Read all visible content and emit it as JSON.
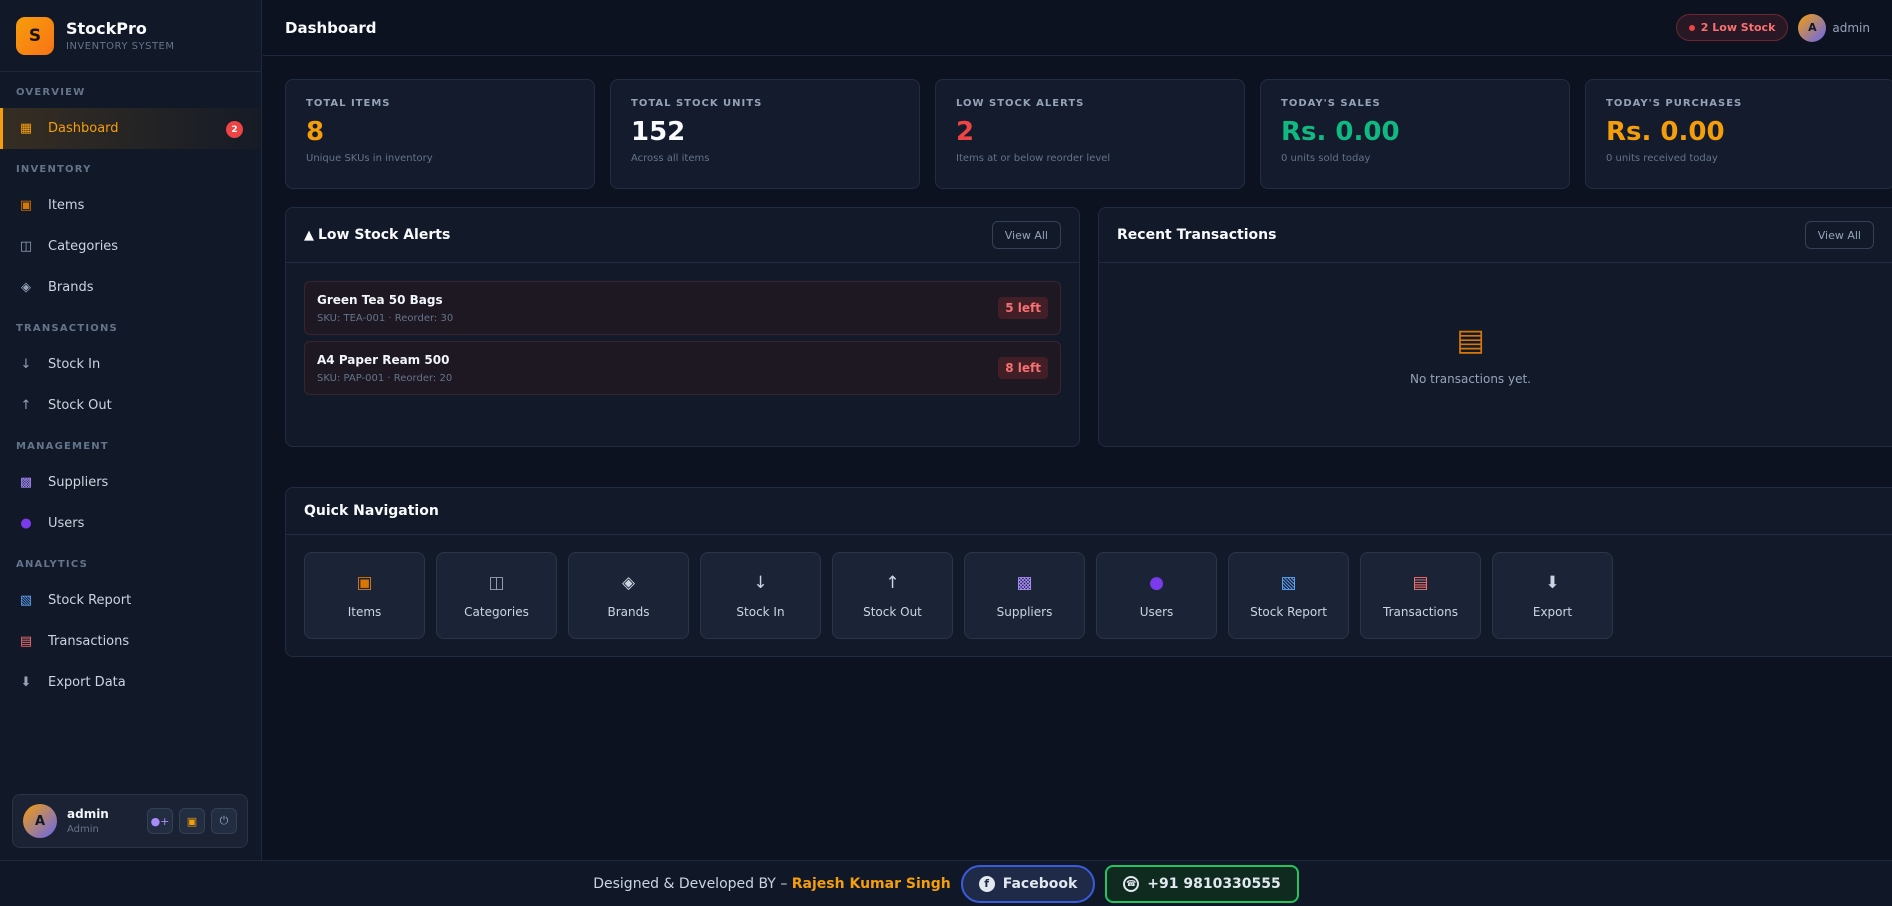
{
  "brand": {
    "logo_letter": "S",
    "name": "StockPro",
    "subtitle": "INVENTORY SYSTEM"
  },
  "sidebar": {
    "sections": {
      "overview": "OVERVIEW",
      "inventory": "INVENTORY",
      "transactions": "TRANSACTIONS",
      "management": "MANAGEMENT",
      "analytics": "ANALYTICS"
    },
    "items": {
      "dashboard": {
        "label": "Dashboard",
        "icon": "grid-icon",
        "badge": "2"
      },
      "items": {
        "label": "Items",
        "icon": "box-icon"
      },
      "categories": {
        "label": "Categories",
        "icon": "tag-icon"
      },
      "brands": {
        "label": "Brands",
        "icon": "diamond-icon"
      },
      "stock_in": {
        "label": "Stock In",
        "icon": "arrow-down-icon"
      },
      "stock_out": {
        "label": "Stock Out",
        "icon": "arrow-up-icon"
      },
      "suppliers": {
        "label": "Suppliers",
        "icon": "factory-icon"
      },
      "users": {
        "label": "Users",
        "icon": "user-icon"
      },
      "stock_report": {
        "label": "Stock Report",
        "icon": "chart-icon"
      },
      "transactions": {
        "label": "Transactions",
        "icon": "clipboard-icon"
      },
      "export": {
        "label": "Export Data",
        "icon": "download-icon"
      }
    }
  },
  "user": {
    "initial": "A",
    "name": "admin",
    "role": "Admin"
  },
  "topbar": {
    "title": "Dashboard",
    "low_stock_label": "2 Low Stock",
    "avatar_initial": "A",
    "username": "admin"
  },
  "stats": [
    {
      "label": "TOTAL ITEMS",
      "value": "8",
      "sub": "Unique SKUs in inventory",
      "color": "#f59e0b"
    },
    {
      "label": "TOTAL STOCK UNITS",
      "value": "152",
      "sub": "Across all items",
      "color": "#f8fafc"
    },
    {
      "label": "LOW STOCK ALERTS",
      "value": "2",
      "sub": "Items at or below reorder level",
      "color": "#ef4444"
    },
    {
      "label": "TODAY'S SALES",
      "value": "Rs. 0.00",
      "sub": "0 units sold today",
      "color": "#10b981"
    },
    {
      "label": "TODAY'S PURCHASES",
      "value": "Rs. 0.00",
      "sub": "0 units received today",
      "color": "#f59e0b"
    }
  ],
  "low_stock": {
    "title": "Low Stock Alerts",
    "view_all": "View All",
    "rows": [
      {
        "name": "Green Tea 50 Bags",
        "sku": "SKU: TEA-001 · Reorder: 30",
        "left": "5 left"
      },
      {
        "name": "A4 Paper Ream 500",
        "sku": "SKU: PAP-001 · Reorder: 20",
        "left": "8 left"
      }
    ]
  },
  "recent": {
    "title": "Recent Transactions",
    "view_all": "View All",
    "empty": "No transactions yet."
  },
  "quick_nav": {
    "title": "Quick Navigation",
    "items": [
      {
        "label": "Items",
        "icon": "box-icon"
      },
      {
        "label": "Categories",
        "icon": "tag-icon"
      },
      {
        "label": "Brands",
        "icon": "diamond-icon"
      },
      {
        "label": "Stock In",
        "icon": "arrow-down-icon"
      },
      {
        "label": "Stock Out",
        "icon": "arrow-up-icon"
      },
      {
        "label": "Suppliers",
        "icon": "factory-icon"
      },
      {
        "label": "Users",
        "icon": "user-icon"
      },
      {
        "label": "Stock Report",
        "icon": "chart-icon"
      },
      {
        "label": "Transactions",
        "icon": "clipboard-icon"
      },
      {
        "label": "Export",
        "icon": "download-icon"
      }
    ]
  },
  "footer": {
    "credit_prefix": "Designed & Developed BY –",
    "author": "Rajesh Kumar Singh",
    "facebook": "Facebook",
    "whatsapp": "+91 9810330555"
  }
}
